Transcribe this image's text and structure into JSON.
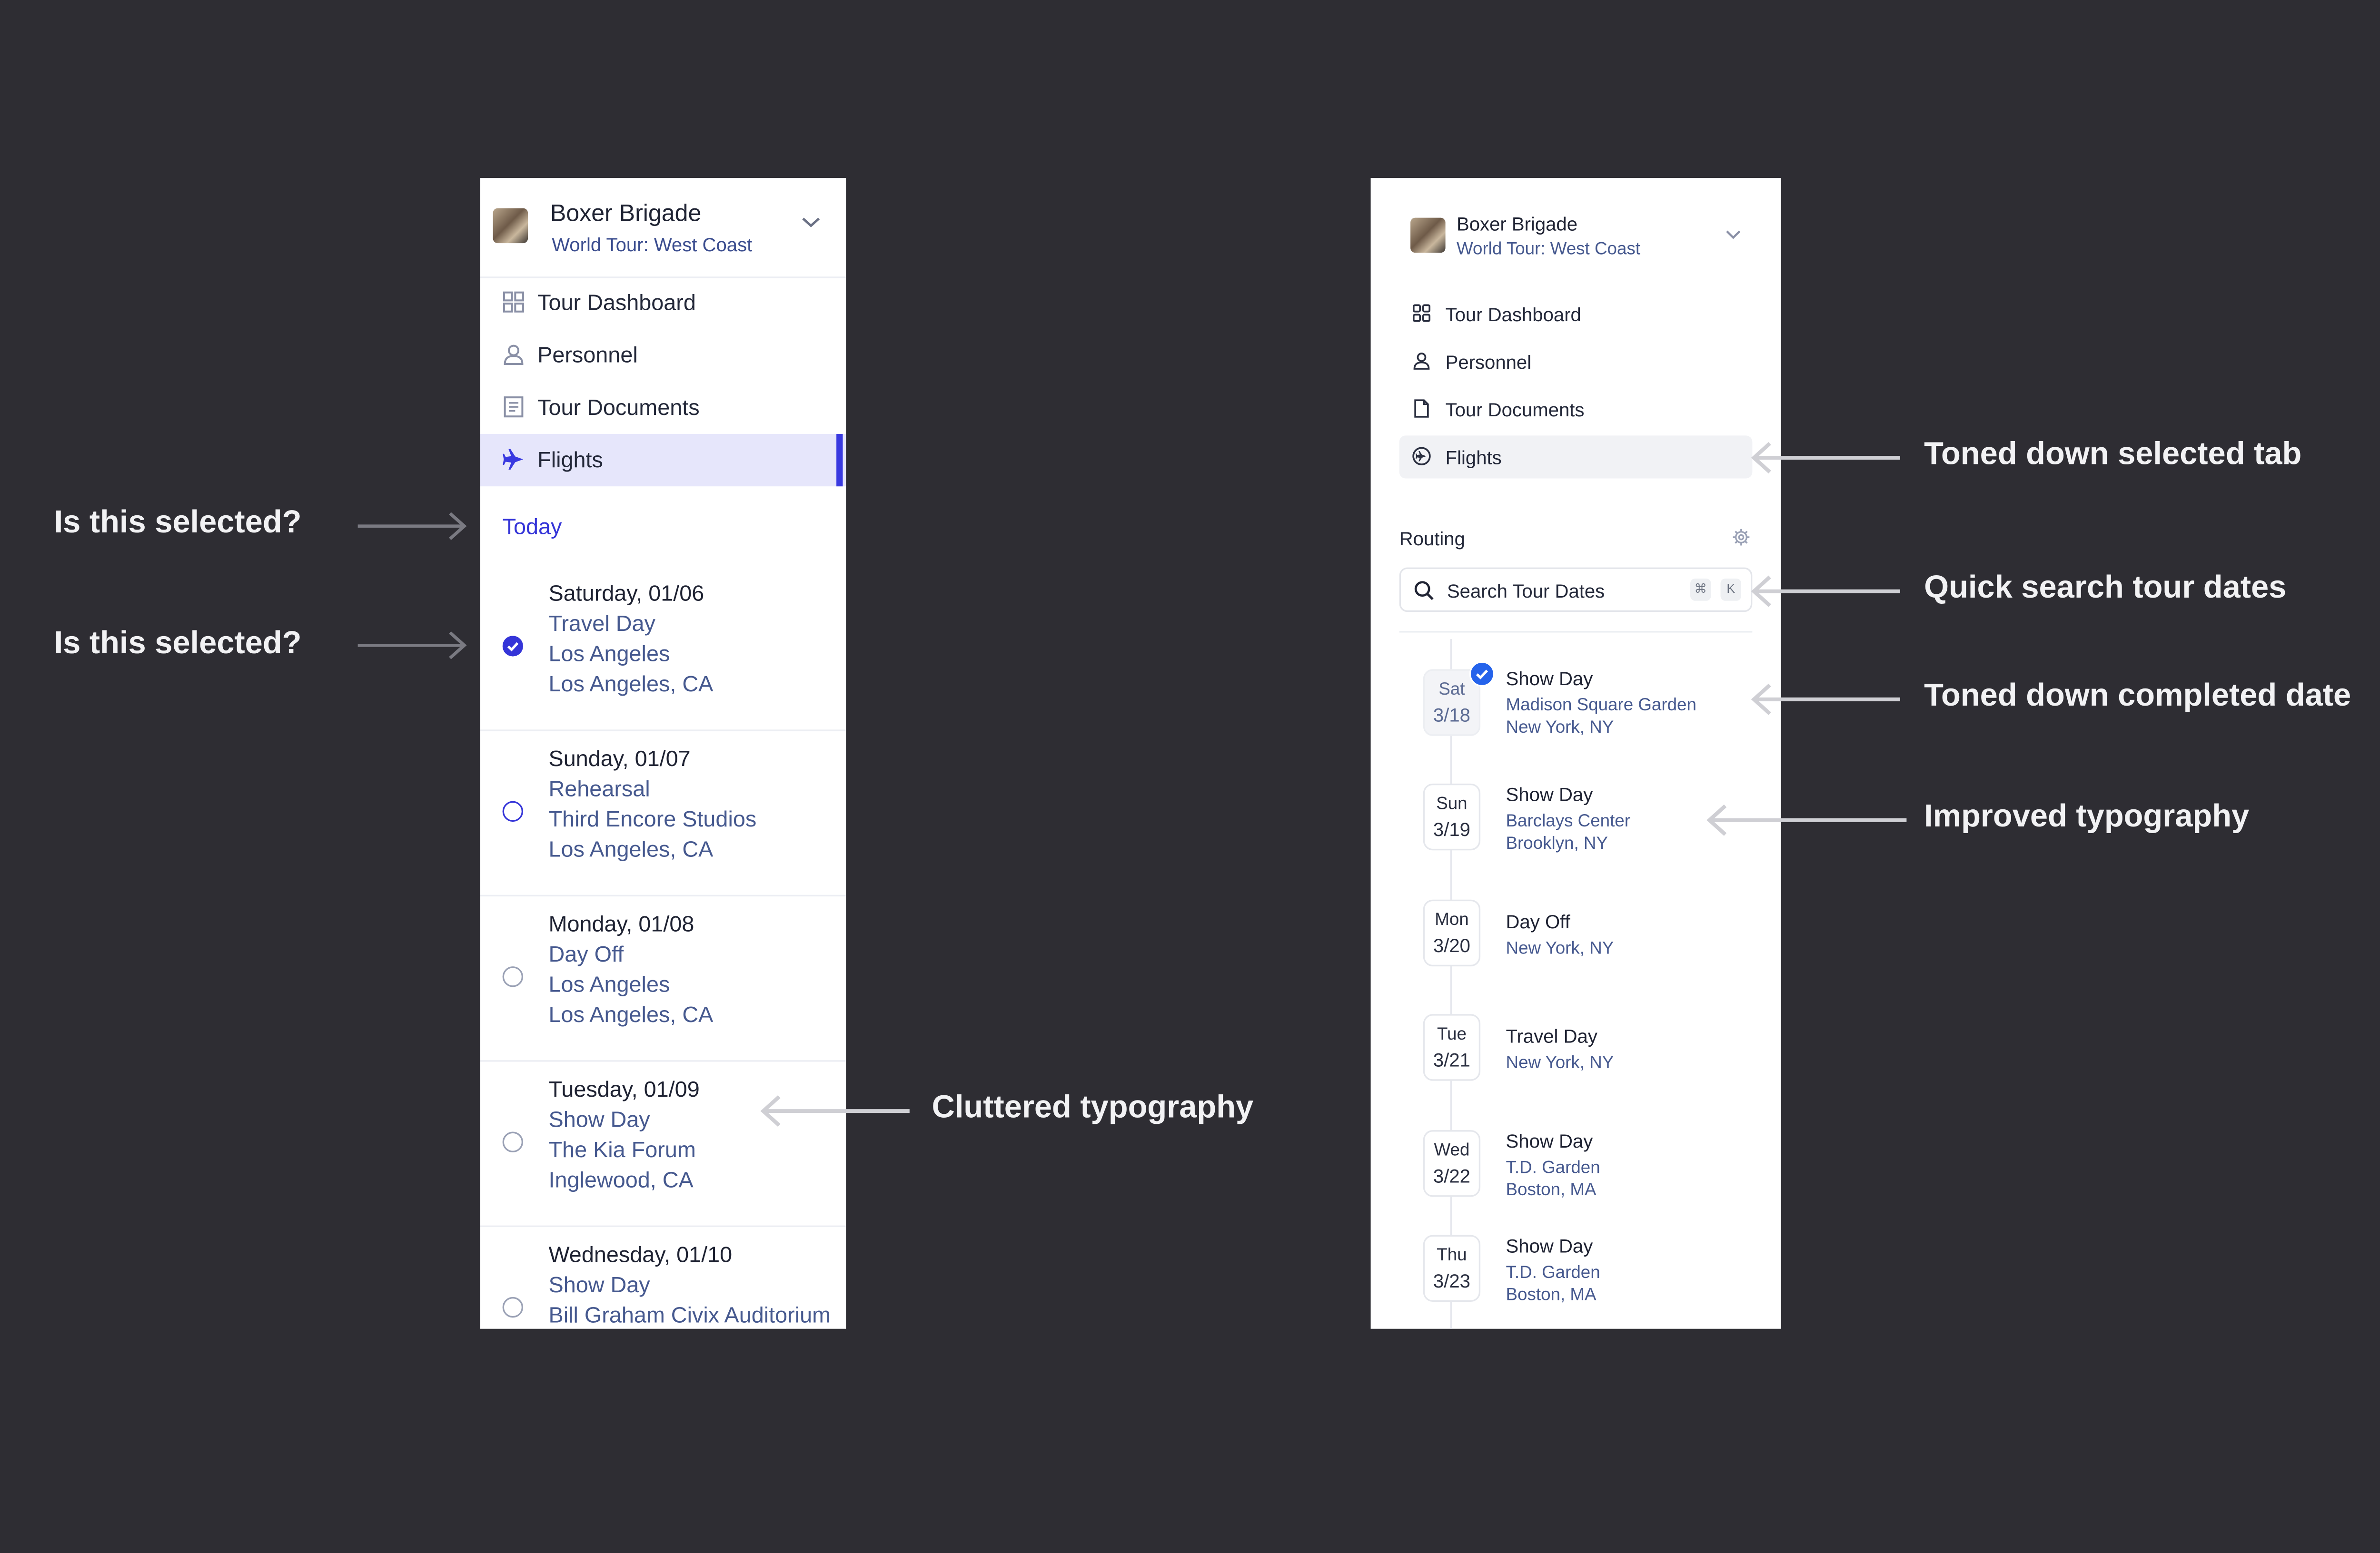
{
  "colors": {
    "background": "#2e2d33",
    "accent_before": "#3939e0",
    "accent_after": "#2563eb",
    "muted_text": "#46598f"
  },
  "before": {
    "header": {
      "title": "Boxer Brigade",
      "subtitle": "World Tour: West Coast",
      "chevron_icon": "chevron-down-icon"
    },
    "nav": [
      {
        "label": "Tour Dashboard",
        "icon": "grid-icon"
      },
      {
        "label": "Personnel",
        "icon": "person-icon"
      },
      {
        "label": "Tour Documents",
        "icon": "document-icon"
      },
      {
        "label": "Flights",
        "icon": "plane-icon",
        "selected": true
      }
    ],
    "today_label": "Today",
    "items": [
      {
        "date": "Saturday, 01/06",
        "type": "Travel Day",
        "venue": "Los Angeles",
        "location": "Los Angeles, CA",
        "state": "checked"
      },
      {
        "date": "Sunday, 01/07",
        "type": "Rehearsal",
        "venue": "Third Encore Studios",
        "location": "Los Angeles, CA",
        "state": "active"
      },
      {
        "date": "Monday, 01/08",
        "type": "Day Off",
        "venue": "Los Angeles",
        "location": "Los Angeles, CA",
        "state": "empty"
      },
      {
        "date": "Tuesday, 01/09",
        "type": "Show Day",
        "venue": "The Kia Forum",
        "location": "Inglewood, CA",
        "state": "empty"
      },
      {
        "date": "Wednesday, 01/10",
        "type": "Show Day",
        "venue": "Bill Graham Civix Auditorium",
        "location": "",
        "state": "empty"
      }
    ]
  },
  "after": {
    "header": {
      "title": "Boxer Brigade",
      "subtitle": "World Tour: West Coast",
      "chevron_icon": "chevron-down-icon"
    },
    "nav": [
      {
        "label": "Tour Dashboard",
        "icon": "grid-icon"
      },
      {
        "label": "Personnel",
        "icon": "person-icon"
      },
      {
        "label": "Tour Documents",
        "icon": "document-icon"
      },
      {
        "label": "Flights",
        "icon": "plane-circle-icon",
        "selected": true
      }
    ],
    "section_title": "Routing",
    "search": {
      "placeholder": "Search Tour Dates",
      "shortcut_keys": [
        "⌘",
        "K"
      ]
    },
    "dates": [
      {
        "dow": "Sat",
        "md": "3/18",
        "type": "Show Day",
        "venue": "Madison Square Garden",
        "location": "New York, NY",
        "completed": true
      },
      {
        "dow": "Sun",
        "md": "3/19",
        "type": "Show Day",
        "venue": "Barclays Center",
        "location": "Brooklyn, NY",
        "completed": false
      },
      {
        "dow": "Mon",
        "md": "3/20",
        "type": "Day Off",
        "venue": "",
        "location": "New York, NY",
        "completed": false
      },
      {
        "dow": "Tue",
        "md": "3/21",
        "type": "Travel Day",
        "venue": "",
        "location": "New York, NY",
        "completed": false
      },
      {
        "dow": "Wed",
        "md": "3/22",
        "type": "Show Day",
        "venue": "T.D. Garden",
        "location": "Boston, MA",
        "completed": false
      },
      {
        "dow": "Thu",
        "md": "3/23",
        "type": "Show Day",
        "venue": "T.D. Garden",
        "location": "Boston, MA",
        "completed": false
      }
    ]
  },
  "annotations": {
    "left_1": "Is this selected?",
    "left_2": "Is this selected?",
    "cluttered": "Cluttered typography",
    "toned_tab": "Toned down selected tab",
    "quick_search": "Quick search tour dates",
    "toned_date": "Toned down completed date",
    "improved": "Improved typography"
  }
}
